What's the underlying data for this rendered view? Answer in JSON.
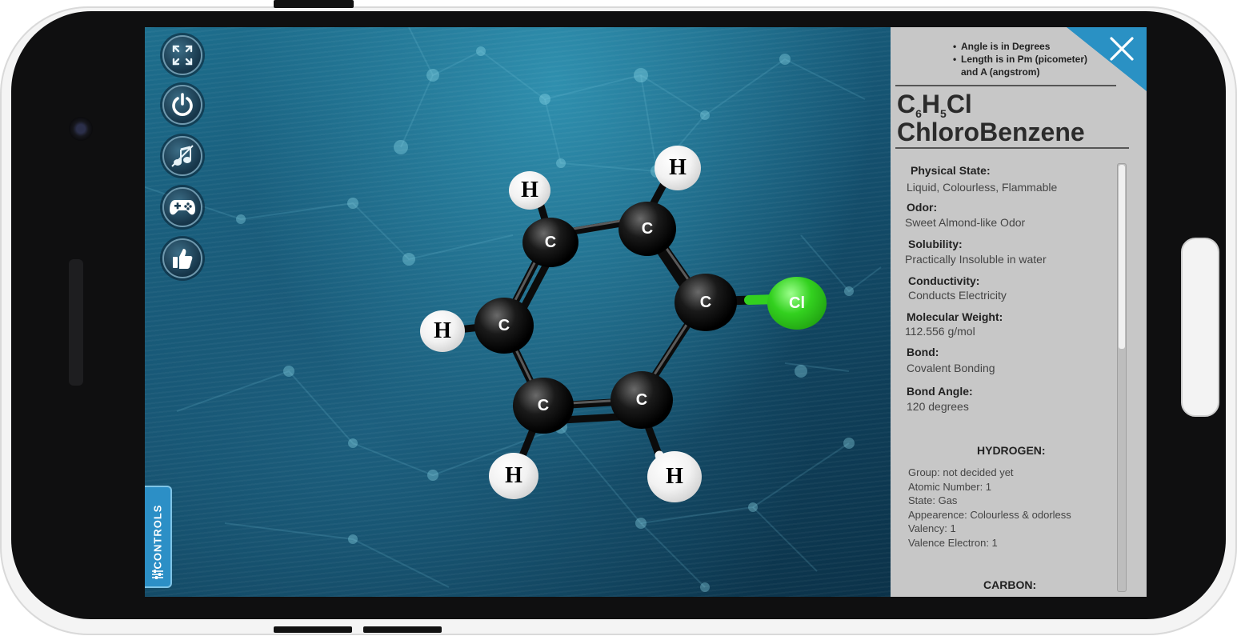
{
  "toolbar": {
    "buttons": [
      {
        "icon": "fullscreen-icon"
      },
      {
        "icon": "power-icon"
      },
      {
        "icon": "music-icon"
      },
      {
        "icon": "gamepad-icon"
      },
      {
        "icon": "thumbs-up-icon"
      }
    ],
    "controls_label": "CONTROLS"
  },
  "molecule": {
    "atoms": [
      {
        "symbol": "C"
      },
      {
        "symbol": "C"
      },
      {
        "symbol": "C"
      },
      {
        "symbol": "C"
      },
      {
        "symbol": "C"
      },
      {
        "symbol": "C"
      },
      {
        "symbol": "H"
      },
      {
        "symbol": "H"
      },
      {
        "symbol": "H"
      },
      {
        "symbol": "H"
      },
      {
        "symbol": "H"
      },
      {
        "symbol": "Cl"
      }
    ]
  },
  "panel": {
    "notes": [
      "Angle is in Degrees",
      "Length is in Pm (picometer)",
      "and A (angstrom)"
    ],
    "formula": {
      "c": "C",
      "c_n": "6",
      "h": "H",
      "h_n": "5",
      "rest": "Cl"
    },
    "name": "ChloroBenzene",
    "properties": [
      {
        "label": "Physical State:",
        "value": "Liquid, Colourless, Flammable"
      },
      {
        "label": "Odor:",
        "value": "Sweet Almond-like Odor"
      },
      {
        "label": "Solubility:",
        "value": "Practically Insoluble in water"
      },
      {
        "label": "Conductivity:",
        "value": "Conducts Electricity"
      },
      {
        "label": "Molecular Weight:",
        "value": "112.556 g/mol"
      },
      {
        "label": "Bond:",
        "value": "Covalent Bonding"
      },
      {
        "label": "Bond Angle:",
        "value": "120 degrees"
      }
    ],
    "hydrogen": {
      "title": "HYDROGEN:",
      "lines": [
        "Group: not decided yet",
        "Atomic Number: 1",
        "State: Gas",
        "Appearence: Colourless & odorless",
        "Valency: 1",
        "Valence Electron: 1"
      ]
    },
    "carbon": {
      "title": "CARBON:"
    }
  },
  "colors": {
    "accent": "#2a91c4",
    "panel_bg": "#c7c7c7",
    "chlorine": "#33d11f",
    "scene_bg": "#14506e"
  }
}
